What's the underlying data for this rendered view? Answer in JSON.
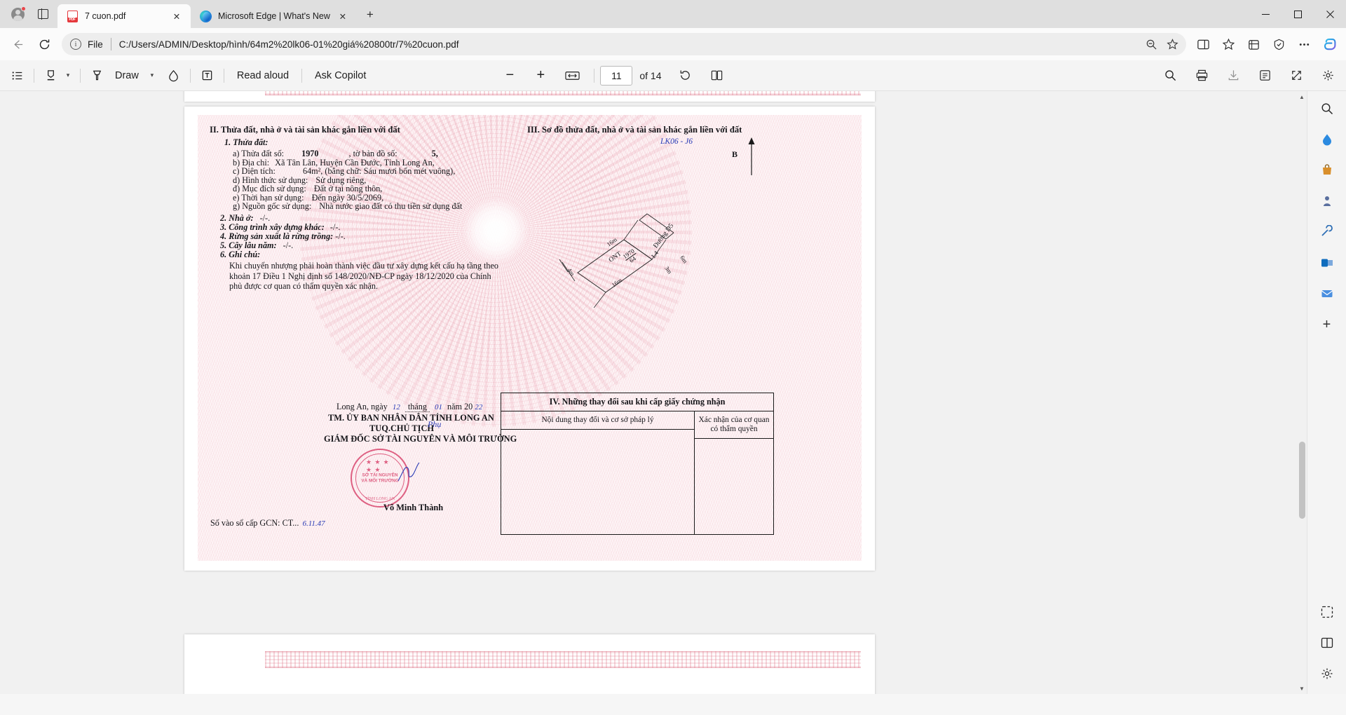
{
  "window": {
    "minimize_label": "–",
    "maximize_label": "☐",
    "close_label": "✕"
  },
  "tabs": [
    {
      "title": "7 cuon.pdf",
      "favicon": "pdf-icon",
      "active": true,
      "close_label": "✕"
    },
    {
      "title": "Microsoft Edge | What's New",
      "favicon": "edge-icon",
      "active": false,
      "close_label": "✕"
    }
  ],
  "newtab_label": "+",
  "address": {
    "back_label": "←",
    "refresh_label": "⟳",
    "info_icon": "info-icon",
    "scheme_label": "File",
    "url": "C:/Users/ADMIN/Desktop/hình/64m2%20lk06-01%20giá%20800tr/7%20cuon.pdf",
    "zoom_out_icon": "zoom-out-icon",
    "favorite_icon": "star-icon",
    "split_icon": "split-screen-icon",
    "collections_icon": "collections-icon",
    "browser_essentials_icon": "browser-essentials-icon",
    "settings_icon": "ellipsis-icon",
    "copilot_icon": "copilot-icon"
  },
  "pdf_toolbar": {
    "toc_label": "table-of-contents-icon",
    "highlight_label": "highlight-icon",
    "highlight_caret": "▾",
    "draw_icon": "draw-icon",
    "draw_label": "Draw",
    "draw_caret": "▾",
    "erase_icon": "eraser-icon",
    "text_icon": "add-text-icon",
    "read_aloud_label": "Read aloud",
    "ask_copilot_label": "Ask Copilot",
    "zoom_out_label": "−",
    "zoom_in_label": "+",
    "fit_label": "fit-page-icon",
    "page_number": "11",
    "page_total": "of 14",
    "rotate_icon": "rotate-icon",
    "view_layout_icon": "page-view-icon",
    "search_icon": "search-icon",
    "print_icon": "print-icon",
    "save_icon": "save-icon",
    "notes_icon": "notes-icon",
    "fullscreen_icon": "fullscreen-icon",
    "settings_icon": "pdf-settings-icon"
  },
  "document": {
    "section2": {
      "heading": "II. Thửa đất, nhà ở và tài sản khác gắn liền với đất",
      "item1_title": "1. Thửa đất:",
      "lines": [
        {
          "label": "a) Thửa đất số:",
          "value": "1970",
          "label2": ", tờ bản đồ số:",
          "value2": "5,"
        },
        {
          "label": "b) Địa chỉ:",
          "value": "Xã Tân Lân, Huyện Cần Đước, Tỉnh Long An,"
        },
        {
          "label": "c) Diện tích:",
          "value": "64m², (bằng chữ: Sáu mươi bốn mét vuông),"
        },
        {
          "label": "d) Hình thức sử dụng:",
          "value": "Sử dụng riêng,"
        },
        {
          "label": "đ) Mục đích sử dụng:",
          "value": "Đất ở tại nông thôn,"
        },
        {
          "label": "e) Thời hạn sử dụng:",
          "value": "Đến ngày 30/5/2069,"
        },
        {
          "label": "g) Nguồn gốc sử dụng:",
          "value": "Nhà nước giao đất có thu tiền sử dụng đất"
        }
      ],
      "item2": "2. Nhà ở:",
      "item2_value": "-/-.",
      "item3": "3. Công trình xây dựng khác:",
      "item3_value": "-/-.",
      "item4": "4. Rừng sản xuất là rừng trồng:",
      "item4_value": "-/-.",
      "item5": "5. Cây lâu năm:",
      "item5_value": "-/-.",
      "item6": "6. Ghi chú:",
      "note": "Khi chuyển nhượng phải hoàn thành việc đầu tư xây dựng kết cấu hạ tầng theo khoản 17 Điều 1 Nghị định số 148/2020/NĐ-CP ngày 18/12/2020 của Chính phủ được cơ quan có thẩm quyền xác nhận."
    },
    "section3": {
      "heading": "III. Sơ đồ thửa đất, nhà ở và tài sản khác gắn liền với đất",
      "handwritten_ref": "LK06 - J6",
      "north_label": "B",
      "parcel_code": "ONT",
      "parcel_number": "1970",
      "parcel_area": "64",
      "road_label": "Đường D5",
      "side_label": "L4",
      "dim_top": "16m",
      "dim_bottom": "16m",
      "dim_left": "4m",
      "dim_right_upper": "6m",
      "dim_right_lower": "3m"
    },
    "signature": {
      "place_date_prefix": "Long An, ngày",
      "day": "12",
      "month_word": "tháng",
      "month": "01",
      "year_word": "năm 20",
      "year": "22",
      "line1": "TM. ỦY BAN NHÂN DÂN TỈNH LONG AN",
      "line2": "TUQ.CHỦ TỊCH",
      "line3": "GIÁM ĐỐC SỞ TÀI NGUYÊN VÀ MÔI TRƯỜNG",
      "signer": "Võ Minh Thành",
      "signature_scribble": "Phụ",
      "book_label": "Số vào sổ cấp GCN: CT...",
      "book_number": "6.11.47",
      "stamp": {
        "top_arc": "★  ★  ★  ★  ★",
        "middle": "SỞ TÀI NGUYÊN VÀ MÔI TRƯỜNG",
        "bottom_arc": "TỈNH LONG AN"
      }
    },
    "section4": {
      "heading": "IV. Những thay đổi sau khi cấp giấy chứng nhận",
      "col1": "Nội dung thay đổi và cơ sở pháp lý",
      "col2_line1": "Xác nhận của cơ quan",
      "col2_line2": "có thẩm quyền"
    }
  },
  "rail": {
    "items": [
      {
        "name": "search-rail-icon",
        "glyph": "⌕"
      },
      {
        "name": "edge-drop-icon",
        "glyph": "◆"
      },
      {
        "name": "shopping-icon",
        "glyph": "▤"
      },
      {
        "name": "games-icon",
        "glyph": "♟"
      },
      {
        "name": "tools-icon",
        "glyph": "⚙"
      },
      {
        "name": "outlook-icon",
        "glyph": "O"
      },
      {
        "name": "teams-icon",
        "glyph": "✉"
      },
      {
        "name": "add-rail-icon",
        "glyph": "+"
      }
    ],
    "bottom_items": [
      {
        "name": "screenshot-icon",
        "glyph": "⬚"
      },
      {
        "name": "split-view-icon",
        "glyph": "◫"
      },
      {
        "name": "rail-settings-icon",
        "glyph": "⚙"
      }
    ]
  },
  "scrollbar": {
    "up_label": "▲",
    "down_label": "▼"
  },
  "colors": {
    "accent": "#0f63c8",
    "pdf_red": "#e5393d",
    "cert_pink": "#e7939f",
    "stamp_red": "#d8416a",
    "handwriting_blue": "#2a3bb5"
  }
}
